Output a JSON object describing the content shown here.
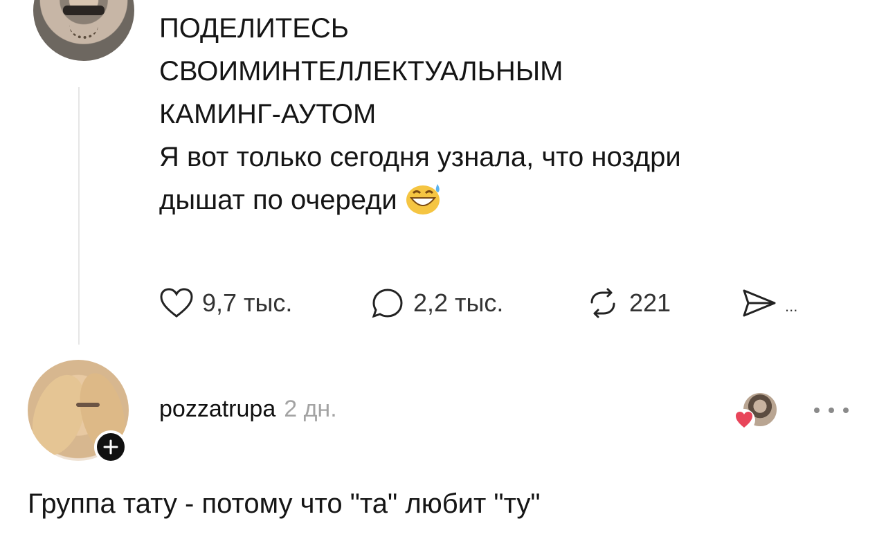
{
  "post": {
    "lines": [
      "ПОДЕЛИТЕСЬ",
      "СВОИМИНТЕЛЛЕКТУАЛЬНЫМ",
      "КАМИНГ-АУТОМ",
      "Я вот только сегодня узнала, что ноздри",
      "дышат по очереди"
    ],
    "emoji": "grinning-face-with-sweat"
  },
  "actions": {
    "likes": "9,7 тыс.",
    "comments": "2,2 тыс.",
    "reposts": "221",
    "share_more": "..."
  },
  "comment": {
    "username": "pozzatrupa",
    "time": "2 дн.",
    "text": "Группа тату - потому что \"та\" любит \"ту\""
  },
  "colors": {
    "heart_badge": "#e8455a",
    "follow_badge": "#111111",
    "muted_text": "#a3a3a3"
  }
}
